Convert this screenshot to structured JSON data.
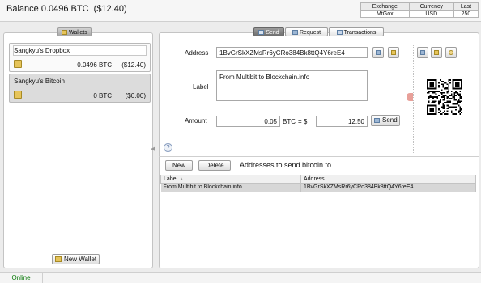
{
  "balance": {
    "label": "Balance",
    "btc": "0.0496 BTC",
    "fiat": "($12.40)"
  },
  "ticker": {
    "headers": [
      "Exchange",
      "Currency",
      "Last"
    ],
    "row": [
      "MtGox",
      "USD",
      "250"
    ]
  },
  "wallets": {
    "tab_label": "Wallets",
    "items": [
      {
        "name": "Sangkyu's Dropbox",
        "btc": "0.0496 BTC",
        "fiat": "($12.40)"
      },
      {
        "name": "Sangkyu's Bitcoin",
        "btc": "0 BTC",
        "fiat": "($0.00)"
      }
    ],
    "new_wallet_label": "New Wallet"
  },
  "tabs": {
    "send": "Send",
    "request": "Request",
    "transactions": "Transactions"
  },
  "send_form": {
    "address_label": "Address",
    "address_value": "1BvGrSkXZMsRr6yCRo384Bk8ttQ4Y6reE4",
    "label_label": "Label",
    "label_value": "From Multibit to Blockchain.info",
    "amount_label": "Amount",
    "amount_btc": "0.05",
    "btc_unit": "BTC",
    "equals_dollar": "= $",
    "amount_usd": "12.50",
    "send_button": "Send",
    "help": "?"
  },
  "address_book": {
    "new_button": "New",
    "delete_button": "Delete",
    "title": "Addresses to send bitcoin to",
    "columns": [
      "Label",
      "Address"
    ],
    "sort_indicator": "▲",
    "rows": [
      {
        "label": "From Multibit to Blockchain.info",
        "address": "1BvGrSkXZMsRr6yCRo384Bk8ttQ4Y6reE4"
      }
    ]
  },
  "status": {
    "online": "Online"
  },
  "colors": {
    "online": "#0a7a0a",
    "selected_row": "#d7d7d7",
    "send_tab": "#7a7a7a"
  }
}
